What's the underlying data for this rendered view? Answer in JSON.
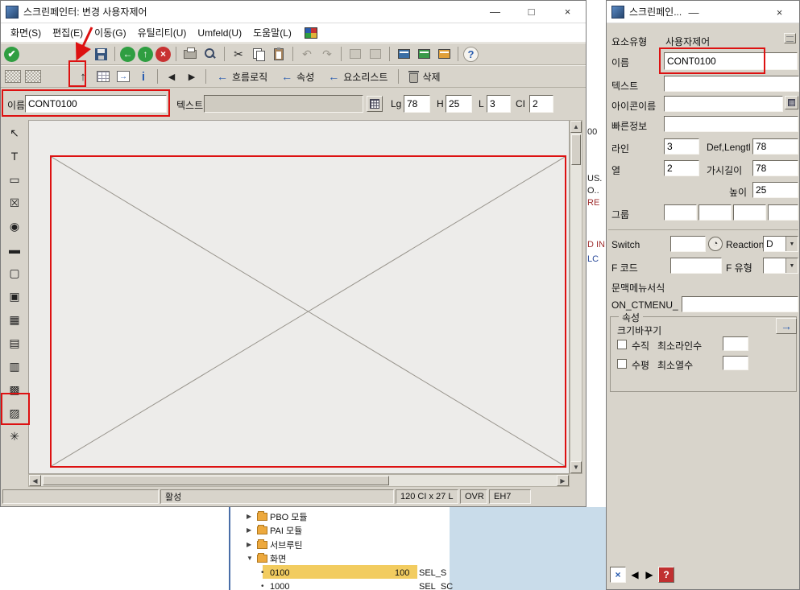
{
  "colors": {
    "accent_red": "#dd1111",
    "window_bg": "#d8d4cb",
    "titlebar_bg": "#ffffff",
    "canvas_bg": "#edecea",
    "selection_yellow": "#f2cc60",
    "folder_yellow": "#eda93d",
    "lightblue_bg": "#c9dcea",
    "check_green": "#2f9e41",
    "cancel_red": "#c83232",
    "info_blue": "#2a5db0"
  },
  "glyphs": {
    "check": "✔",
    "back": "←",
    "exit": "↑",
    "cancel": "×",
    "cut": "✂",
    "undo": "↶",
    "redo": "↷",
    "info": "i",
    "help": "?",
    "nav_prev": "◀",
    "nav_next": "▶",
    "left_arrow": "←",
    "right_arrow": "→",
    "up_arrow": "↑",
    "scroll_up": "▲",
    "scroll_down": "▼",
    "scroll_left": "◀",
    "scroll_right": "▶",
    "dropdown_arrow": "▼",
    "minimize": "—",
    "maximize": "□",
    "close": "×",
    "switch_circle": "◔",
    "tree_collapsed": "▶",
    "tree_expanded": "▼",
    "leaf_bullet": "•",
    "close_x_blue": "×",
    "help_red": "?"
  },
  "main_window": {
    "title": "스크린페인터: 변경 사용자제어",
    "menu": [
      {
        "label": "화면(S)"
      },
      {
        "label": "편집(E)"
      },
      {
        "label": "이동(G)"
      },
      {
        "label": "유틸리티(U)"
      },
      {
        "label": "Umfeld(U)"
      },
      {
        "label": "도움말(L)"
      }
    ],
    "toolbar2": {
      "flow_logic": "흐름로직",
      "attributes": "속성",
      "element_list": "요소리스트",
      "delete_label": "삭제"
    },
    "form": {
      "name_label": "이름",
      "name_value": "CONT0100",
      "text_label": "텍스트",
      "text_value": "",
      "lg_label": "Lg",
      "lg_value": "78",
      "h_label": "H",
      "h_value": "25",
      "l_label": "L",
      "l_value": "3",
      "ci_label": "CI",
      "ci_value": "2"
    },
    "tool_palette": [
      {
        "name": "pointer",
        "glyph": "↖"
      },
      {
        "name": "text",
        "glyph": "T"
      },
      {
        "name": "entry-field",
        "glyph": "▭"
      },
      {
        "name": "checkbox",
        "glyph": "☒"
      },
      {
        "name": "radiobutton",
        "glyph": "◉"
      },
      {
        "name": "pushbutton",
        "glyph": "▬"
      },
      {
        "name": "frame",
        "glyph": "▢"
      },
      {
        "name": "subscreen",
        "glyph": "▣"
      },
      {
        "name": "table-control",
        "glyph": "▦"
      },
      {
        "name": "tabstrip",
        "glyph": "▤"
      },
      {
        "name": "grid",
        "glyph": "▥"
      },
      {
        "name": "tree",
        "glyph": "▩"
      },
      {
        "name": "custom-control",
        "glyph": "▨"
      },
      {
        "name": "status-icon",
        "glyph": "✳"
      }
    ],
    "statusbar": {
      "status": "활성",
      "position": "120 CI x 27 L",
      "mode": "OVR",
      "system": "EH7"
    }
  },
  "right_panel": {
    "title": "스크린페인...",
    "element_type_label": "요소유형",
    "element_type_value": "사용자제어",
    "name_label": "이름",
    "name_value": "CONT0100",
    "text_label": "텍스트",
    "text_value": "",
    "icon_name_label": "아이콘이름",
    "icon_name_value": "",
    "quick_info_label": "빠른정보",
    "quick_info_value": "",
    "line_label": "라인",
    "line_value": "3",
    "def_length_label": "Def,Lengtl",
    "def_length_value": "78",
    "column_label": "열",
    "column_value": "2",
    "visible_length_label": "가시길이",
    "visible_length_value": "78",
    "height_label": "높이",
    "height_value": "25",
    "group_label": "그룹",
    "group_values": [
      "",
      "",
      "",
      ""
    ],
    "switch_label": "Switch",
    "switch_value": "",
    "reaction_label": "Reaction",
    "reaction_value": "D",
    "fcode_label": "F 코드",
    "fcode_value": "",
    "ftype_label": "F 유형",
    "ftype_value": "",
    "context_menu_label": "문맥메뉴서식",
    "context_menu_prefix": "ON_CTMENU_",
    "context_menu_value": "",
    "attributes_group": {
      "legend": "속성",
      "resize_label": "크기바꾸기",
      "vertical_label": "수직",
      "min_lines_label": "최소라인수",
      "min_lines_value": "",
      "horizontal_label": "수평",
      "min_cols_label": "최소열수",
      "min_cols_value": ""
    }
  },
  "background_window": {
    "fragments": [
      {
        "text": "00"
      },
      {
        "text": "US."
      },
      {
        "text": "O.."
      },
      {
        "text": "RE"
      },
      {
        "text": "D IN"
      },
      {
        "text": "LC"
      }
    ],
    "tree_folders": [
      {
        "label": "PBO 모듈"
      },
      {
        "label": "PAI 모듈"
      },
      {
        "label": "서브루틴"
      },
      {
        "label": "화면"
      }
    ],
    "tree_leaves": [
      {
        "label": "0100",
        "col2": "100",
        "col3": "SEL_S"
      },
      {
        "label": "1000",
        "col2": "",
        "col3": "SEL_SC"
      }
    ]
  }
}
